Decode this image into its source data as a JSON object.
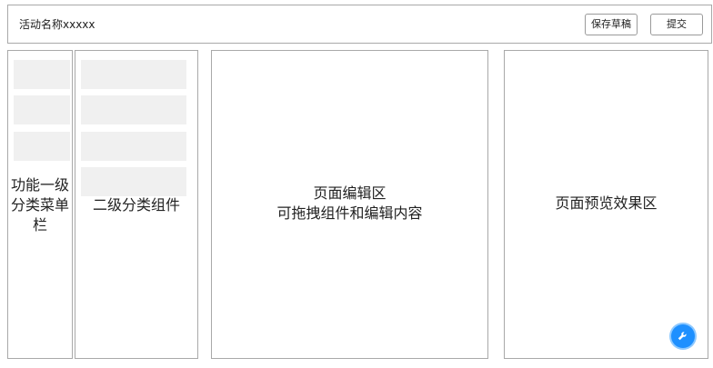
{
  "header": {
    "title": "活动名称xxxxx",
    "save_draft_label": "保存草稿",
    "submit_label": "提交"
  },
  "panels": {
    "primary_menu": {
      "label": "功能一级分类菜单栏"
    },
    "secondary_components": {
      "label": "二级分类组件"
    },
    "editor": {
      "label_line1": "页面编辑区",
      "label_line2": "可拖拽组件和编辑内容"
    },
    "preview": {
      "label": "页面预览效果区"
    }
  },
  "fab": {
    "icon": "wrench-icon"
  },
  "colors": {
    "fab": "#1e90ff",
    "placeholder_block": "#f0f0f0",
    "border": "#a9a9a9"
  }
}
